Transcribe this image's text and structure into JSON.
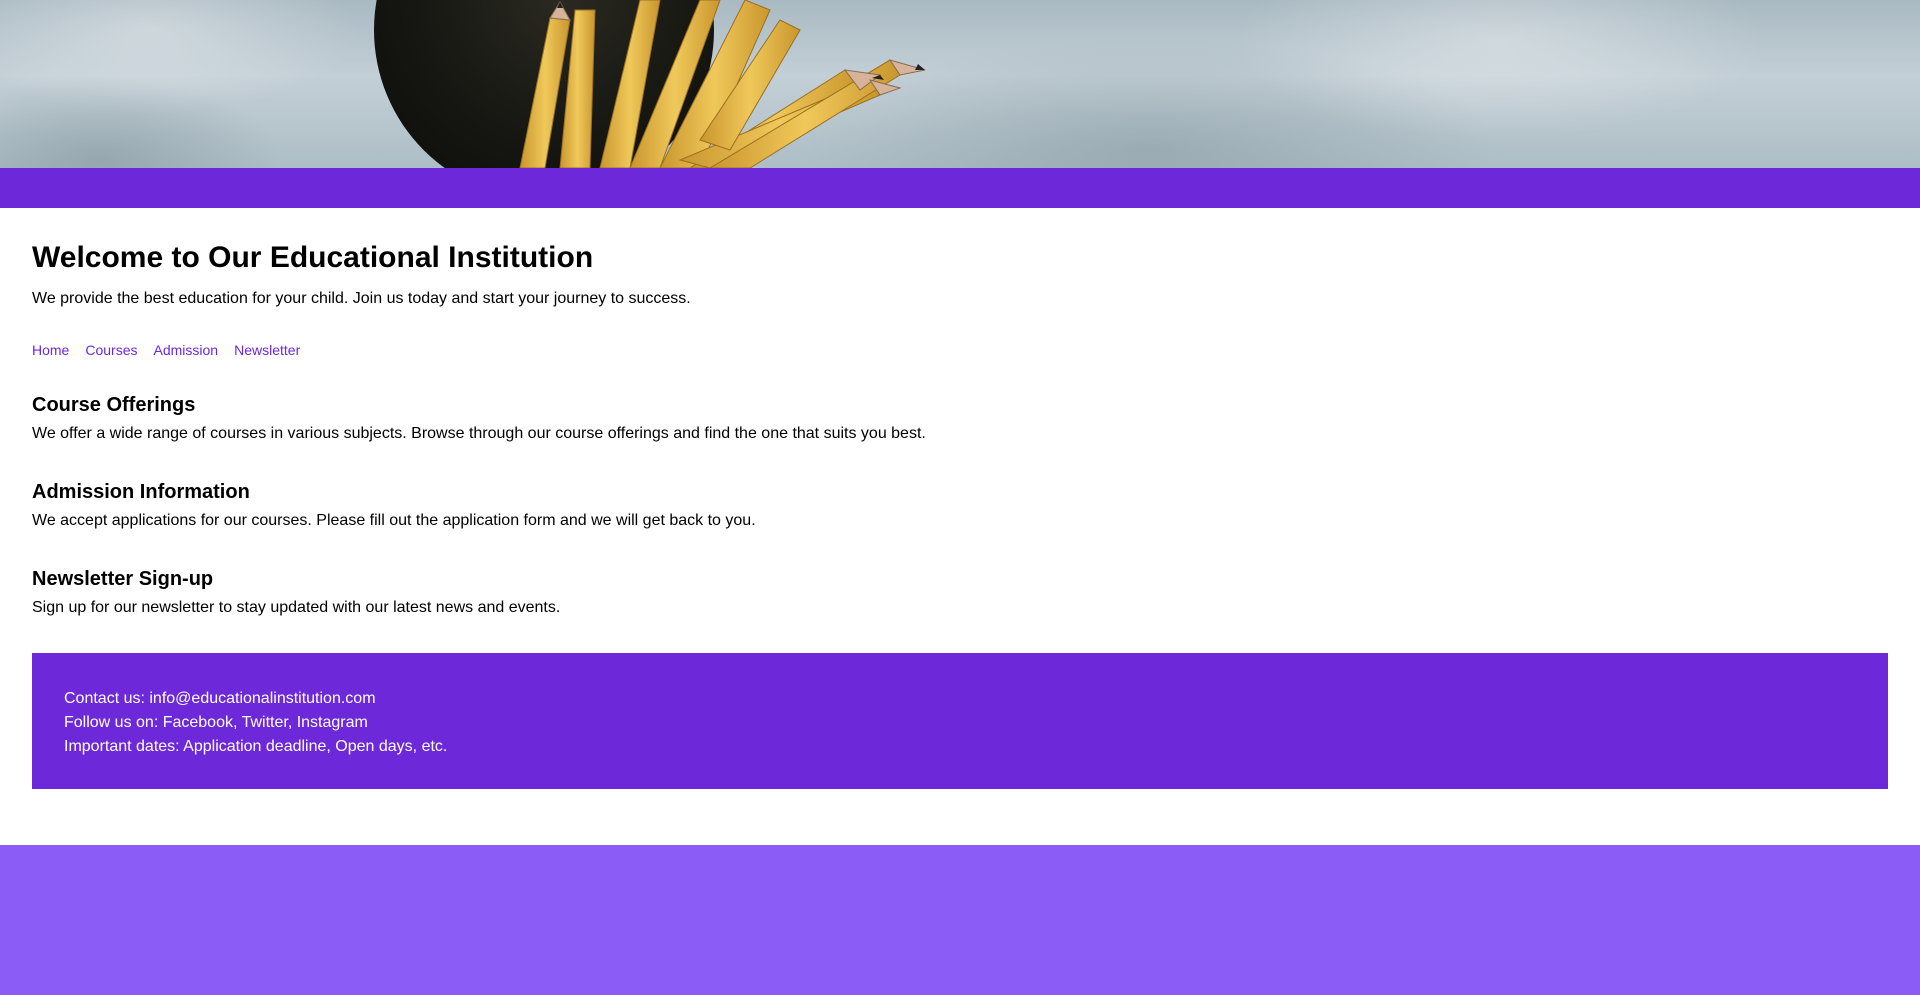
{
  "hero": {
    "image": "pencils-in-cup-photo"
  },
  "page": {
    "title": "Welcome to Our Educational Institution",
    "intro": "We provide the best education for your child. Join us today and start your journey to success."
  },
  "nav": {
    "items": [
      {
        "label": "Home"
      },
      {
        "label": "Courses"
      },
      {
        "label": "Admission"
      },
      {
        "label": "Newsletter"
      }
    ]
  },
  "sections": [
    {
      "heading": "Course Offerings",
      "text": "We offer a wide range of courses in various subjects. Browse through our course offerings and find the one that suits you best."
    },
    {
      "heading": "Admission Information",
      "text": "We accept applications for our courses. Please fill out the application form and we will get back to you."
    },
    {
      "heading": "Newsletter Sign-up",
      "text": "Sign up for our newsletter to stay updated with our latest news and events."
    }
  ],
  "footer": {
    "contact": "Contact us: info@educationalinstitution.com",
    "social": "Follow us on: Facebook, Twitter, Instagram",
    "dates": "Important dates: Application deadline, Open days, etc."
  },
  "colors": {
    "accent": "#6d28d9",
    "light_accent": "#8b5cf6",
    "link": "#6d28d9"
  }
}
